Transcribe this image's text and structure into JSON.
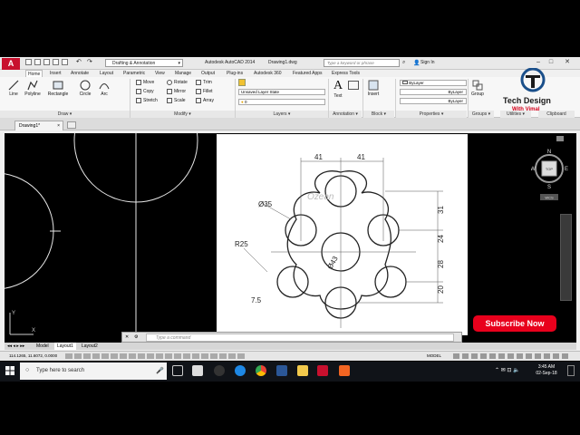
{
  "titlebar": {
    "workspace": "Drafting & Annotation",
    "app_title": "Autodesk AutoCAD 2014",
    "document": "Drawing1.dwg",
    "search_placeholder": "Type a keyword or phrase",
    "signin": "Sign In"
  },
  "tabs": [
    "Home",
    "Insert",
    "Annotate",
    "Layout",
    "Parametric",
    "View",
    "Manage",
    "Output",
    "Plug-ins",
    "Autodesk 360",
    "Featured Apps",
    "Express Tools"
  ],
  "draw": {
    "line": "Line",
    "polyline": "Polyline",
    "circle": "Circle",
    "arc": "Arc",
    "rectangle": "Rectangle",
    "label": "Draw"
  },
  "modify": {
    "move": "Move",
    "copy": "Copy",
    "stretch": "Stretch",
    "rotate": "Rotate",
    "mirror": "Mirror",
    "scale": "Scale",
    "trim": "Trim",
    "fillet": "Fillet",
    "array": "Array",
    "label": "Modify"
  },
  "layers": {
    "state": "Unsaved Layer State",
    "current": "0",
    "label": "Layers"
  },
  "annotation": {
    "text": "Text",
    "label": "Annotation"
  },
  "block": {
    "insert": "Insert",
    "label": "Block"
  },
  "properties": {
    "color": "ByLayer",
    "linetype": "ByLayer",
    "lineweight": "ByLayer",
    "label": "Properties"
  },
  "groups": {
    "group": "Group",
    "label": "Groups"
  },
  "utilities": {
    "label": "Utilities"
  },
  "clipboard": {
    "label": "Clipboard"
  },
  "filetab": {
    "name": "Drawing1*"
  },
  "drawing": {
    "dims": [
      "41",
      "41",
      "Ø35",
      "R25",
      "Ø43",
      "7.5",
      "31",
      "24",
      "28",
      "20"
    ],
    "watermark": "Ozean"
  },
  "viewcube": {
    "n": "N",
    "s": "S",
    "e": "E",
    "w": "W",
    "top": "TOP",
    "wcs": "WCS"
  },
  "cmdline": {
    "placeholder": "Type a command"
  },
  "layout_tabs": [
    "Model",
    "Layout1",
    "Layout2"
  ],
  "status": {
    "coords": "114.1265, 11.6072, 0.0000",
    "model": "MODEL"
  },
  "taskbar": {
    "search": "Type here to search",
    "time": "3:45 AM",
    "date": "02-Sep-18"
  },
  "brand": {
    "title": "Tech Design",
    "subtitle": "With Vimal"
  },
  "subscribe": "Subscribe Now",
  "colors": {
    "accent": "#c8102e",
    "subscribe": "#e8001c",
    "taskbar": "#101318"
  }
}
